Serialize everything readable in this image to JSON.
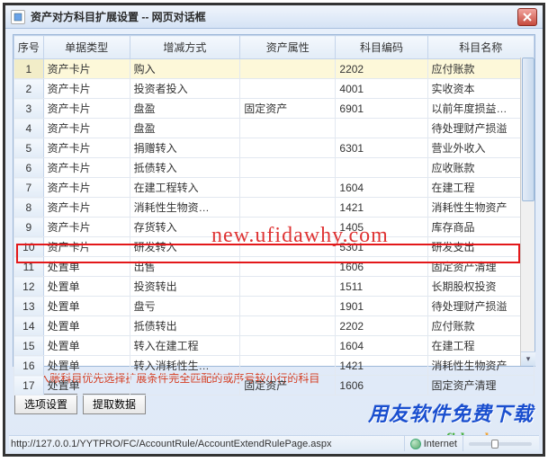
{
  "window": {
    "title": "资产对方科目扩展设置 -- 网页对话框",
    "help_icon": "?"
  },
  "columns": {
    "seq": "序号",
    "doc_type": "单据类型",
    "inc_dec_mode": "增减方式",
    "asset_attr": "资产属性",
    "acct_code": "科目编码",
    "acct_name": "科目名称"
  },
  "rows": [
    {
      "seq": "1",
      "doc_type": "资产卡片",
      "mode": "购入",
      "attr": "",
      "code": "2202",
      "name": "应付账款",
      "selected": true
    },
    {
      "seq": "2",
      "doc_type": "资产卡片",
      "mode": "投资者投入",
      "attr": "",
      "code": "4001",
      "name": "实收资本"
    },
    {
      "seq": "3",
      "doc_type": "资产卡片",
      "mode": "盘盈",
      "attr": "固定资产",
      "code": "6901",
      "name": "以前年度损益…"
    },
    {
      "seq": "4",
      "doc_type": "资产卡片",
      "mode": "盘盈",
      "attr": "",
      "code": "",
      "name": "待处理财产损溢"
    },
    {
      "seq": "5",
      "doc_type": "资产卡片",
      "mode": "捐赠转入",
      "attr": "",
      "code": "6301",
      "name": "营业外收入"
    },
    {
      "seq": "6",
      "doc_type": "资产卡片",
      "mode": "抵债转入",
      "attr": "",
      "code": "",
      "name": "应收账款"
    },
    {
      "seq": "7",
      "doc_type": "资产卡片",
      "mode": "在建工程转入",
      "attr": "",
      "code": "1604",
      "name": "在建工程"
    },
    {
      "seq": "8",
      "doc_type": "资产卡片",
      "mode": "消耗性生物资…",
      "attr": "",
      "code": "1421",
      "name": "消耗性生物资产"
    },
    {
      "seq": "9",
      "doc_type": "资产卡片",
      "mode": "存货转入",
      "attr": "",
      "code": "1405",
      "name": "库存商品"
    },
    {
      "seq": "10",
      "doc_type": "资产卡片",
      "mode": "研发转入",
      "attr": "",
      "code": "5301",
      "name": "研发支出"
    },
    {
      "seq": "11",
      "doc_type": "处置单",
      "mode": "出售",
      "attr": "",
      "code": "1606",
      "name": "固定资产清理",
      "highlight": true
    },
    {
      "seq": "12",
      "doc_type": "处置单",
      "mode": "投资转出",
      "attr": "",
      "code": "1511",
      "name": "长期股权投资"
    },
    {
      "seq": "13",
      "doc_type": "处置单",
      "mode": "盘亏",
      "attr": "",
      "code": "1901",
      "name": "待处理财产损溢"
    },
    {
      "seq": "14",
      "doc_type": "处置单",
      "mode": "抵债转出",
      "attr": "",
      "code": "2202",
      "name": "应付账款"
    },
    {
      "seq": "15",
      "doc_type": "处置单",
      "mode": "转入在建工程",
      "attr": "",
      "code": "1604",
      "name": "在建工程"
    },
    {
      "seq": "16",
      "doc_type": "处置单",
      "mode": "转入消耗性生…",
      "attr": "",
      "code": "1421",
      "name": "消耗性生物资产"
    },
    {
      "seq": "17",
      "doc_type": "处置单",
      "mode": "",
      "attr": "固定资产",
      "code": "1606",
      "name": "固定资产清理"
    }
  ],
  "note": "说明:入账科目优先选择扩展条件完全匹配的或序号较小行的科目",
  "buttons": {
    "options": "选项设置",
    "extract": "提取数据"
  },
  "statusbar": {
    "path": "http://127.0.0.1/YYTPRO/FC/AccountRule/AccountExtendRulePage.aspx",
    "zone": "Internet"
  },
  "watermarks": {
    "center": "new.ufidawhy.com",
    "brand": "用友软件免费下载",
    "footer": "new.ufidawhy.com"
  }
}
